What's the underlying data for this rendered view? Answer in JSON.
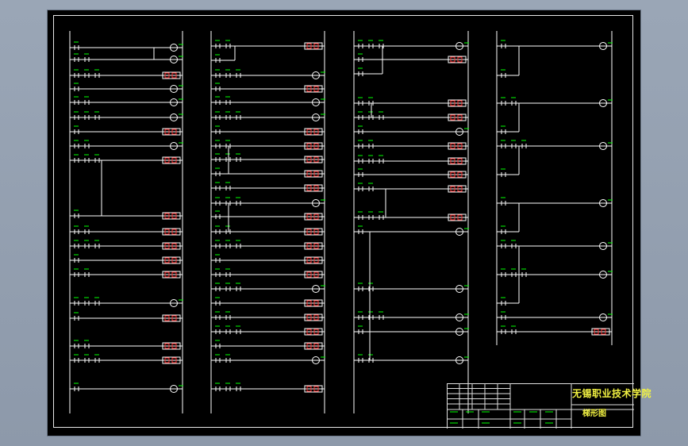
{
  "drawing": {
    "kind": "PLC ladder diagram",
    "colors": {
      "background": "#000000",
      "rail": "#ffffff",
      "contact": "#ffffff",
      "label": "#00ff00",
      "output_box": "#ff3030",
      "title_text": "#f2f242",
      "viewer_background": "#9aa6b6"
    }
  },
  "title_block": {
    "school_name": "无锡职业技术学院",
    "drawing_title": "梯形图"
  }
}
